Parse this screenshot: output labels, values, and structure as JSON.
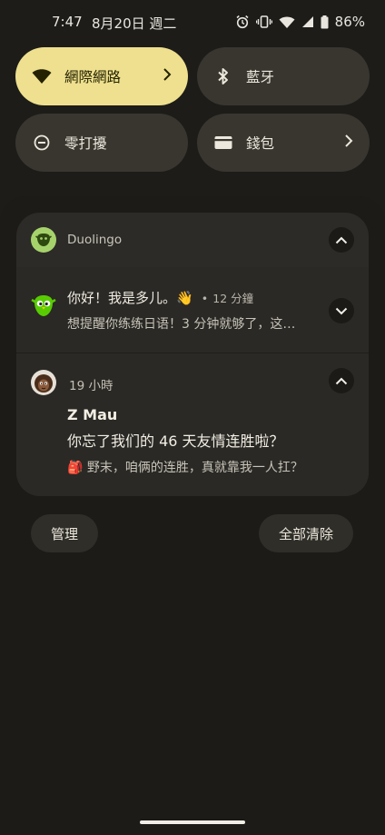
{
  "status_bar": {
    "time": "7:47",
    "date": "8月20日 週二",
    "battery": "86%",
    "icons": [
      "alarm-icon",
      "vibrate-icon",
      "wifi-icon",
      "cell-signal-icon",
      "battery-icon"
    ]
  },
  "quick_tiles": [
    {
      "label": "網際網路",
      "icon": "wifi-icon",
      "active": true,
      "has_chevron": true
    },
    {
      "label": "藍牙",
      "icon": "bluetooth-icon",
      "active": false,
      "has_chevron": false
    },
    {
      "label": "零打擾",
      "icon": "do-not-disturb-icon",
      "active": false,
      "has_chevron": false
    },
    {
      "label": "錢包",
      "icon": "wallet-icon",
      "active": false,
      "has_chevron": true
    }
  ],
  "notification_group": {
    "app_name": "Duolingo",
    "notifications": [
      {
        "title": "你好！我是多儿。👋",
        "time": "12 分鐘",
        "text": "想提醒你练练日语！3 分钟就够了，这…"
      },
      {
        "time": "19 小時",
        "sender": "Z Mau",
        "title": "你忘了我们的 46 天友情连胜啦？",
        "text": "🎒 野末，咱俩的连胜，真就靠我一人扛？"
      }
    ]
  },
  "actions": {
    "manage": "管理",
    "clear_all": "全部清除"
  },
  "colors": {
    "background": "#1d1c19",
    "tile": "#38362f",
    "tile_active": "#eee08e",
    "card": "#2c2b27",
    "duolingo_green": "#a6d26c"
  }
}
